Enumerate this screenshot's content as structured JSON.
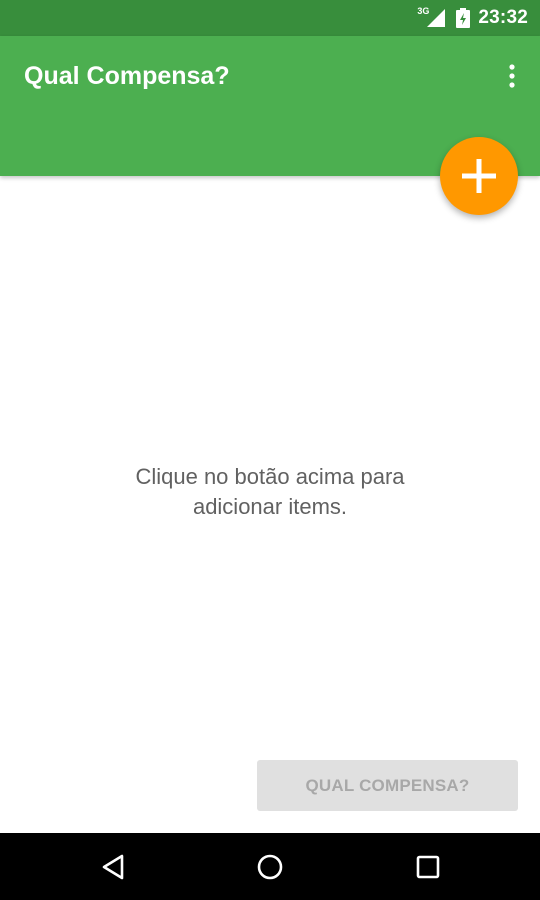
{
  "status_bar": {
    "network": "3G",
    "time": "23:32",
    "icons": [
      "signal-icon",
      "battery-icon"
    ]
  },
  "app_bar": {
    "title": "Qual Compensa?",
    "overflow_icon": "more-vert-icon"
  },
  "fab": {
    "icon": "plus-icon",
    "color": "#FF9800"
  },
  "empty_state": {
    "line1": "Clique no botão acima para",
    "line2": "adicionar items."
  },
  "action_button": {
    "label": "QUAL COMPENSA?",
    "enabled": false
  },
  "nav_bar": {
    "icons": [
      "back-icon",
      "home-icon",
      "recents-icon"
    ]
  },
  "colors": {
    "status_bar": "#388E3C",
    "primary": "#4CAF50",
    "accent": "#FF9800",
    "text_secondary": "#616161",
    "button_disabled_bg": "#E0E0E0",
    "button_disabled_text": "#A8A8A8"
  }
}
